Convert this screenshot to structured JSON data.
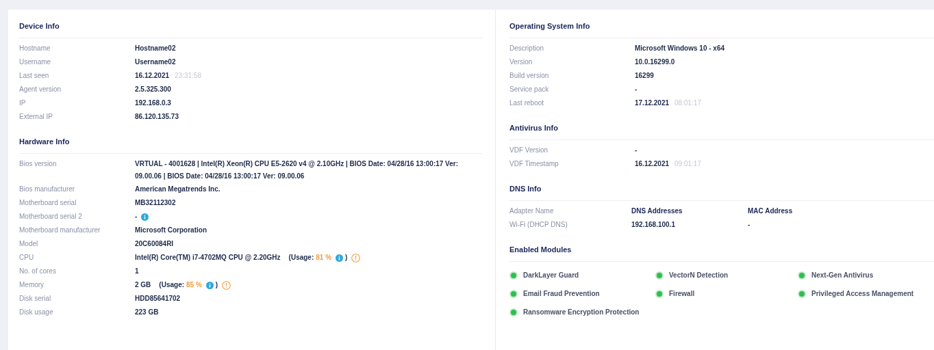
{
  "device_info": {
    "title": "Device Info",
    "rows": [
      {
        "label": "Hostname",
        "value": "Hostname02"
      },
      {
        "label": "Username",
        "value": "Username02"
      },
      {
        "label": "Last seen",
        "value": "16.12.2021",
        "time": "23:31:58"
      },
      {
        "label": "Agent version",
        "value": "2.5.325.300"
      },
      {
        "label": "IP",
        "value": "192.168.0.3"
      },
      {
        "label": "External IP",
        "value": "86.120.135.73"
      }
    ]
  },
  "hardware_info": {
    "title": "Hardware Info",
    "rows": [
      {
        "label": "Bios version",
        "value": "VRTUAL - 4001628 | Intel(R) Xeon(R) CPU E5-2620 v4 @ 2.10GHz | BIOS Date: 04/28/16 13:00:17 Ver: 09.00.06 | BIOS Date: 04/28/16 13:00:17 Ver: 09.00.06",
        "info": false,
        "warning": false
      },
      {
        "label": "Bios manufacturer",
        "value": "American Megatrends Inc.",
        "info": false,
        "warning": false
      },
      {
        "label": "Motherboard serial",
        "value": "MB32112302",
        "info": false,
        "warning": false
      },
      {
        "label": "Motherboard serial 2",
        "value": "-",
        "info": true,
        "warning": false
      },
      {
        "label": "Motherboard manufacturer",
        "value": "Microsoft Corporation",
        "info": false,
        "warning": false
      },
      {
        "label": "Model",
        "value": "20C60084RI",
        "info": false,
        "warning": false
      },
      {
        "label": "CPU",
        "value": "Intel(R) Core(TM) i7-4702MQ CPU @ 2.20GHz",
        "usage": {
          "label": "(Usage:",
          "percent": "81 %",
          "close": ")"
        },
        "info": true,
        "warning": true
      },
      {
        "label": "No. of cores",
        "value": "1",
        "info": false,
        "warning": false
      },
      {
        "label": "Memory",
        "value": "2 GB",
        "usage": {
          "label": "(Usage:",
          "percent": "85 %",
          "close": ")"
        },
        "info": true,
        "warning": true
      },
      {
        "label": "Disk serial",
        "value": "HDD85641702",
        "info": false,
        "warning": false
      },
      {
        "label": "Disk usage",
        "value": "223 GB",
        "info": false,
        "warning": false
      }
    ]
  },
  "os_info": {
    "title": "Operating System Info",
    "rows": [
      {
        "label": "Description",
        "value": "Microsoft Windows 10 - x64"
      },
      {
        "label": "Version",
        "value": "10.0.16299.0"
      },
      {
        "label": "Build version",
        "value": "16299"
      },
      {
        "label": "Service pack",
        "value": "-"
      },
      {
        "label": "Last reboot",
        "value": "17.12.2021",
        "time": "08:01:17"
      }
    ]
  },
  "antivirus_info": {
    "title": "Antivirus Info",
    "rows": [
      {
        "label": "VDF Version",
        "value": "-"
      },
      {
        "label": "VDF Timestamp",
        "value": "16.12.2021",
        "time": "09:01:17"
      }
    ]
  },
  "dns_info": {
    "title": "DNS Info",
    "columns": [
      "Adapter Name",
      "DNS Addresses",
      "MAC Address"
    ],
    "rows": [
      [
        "Wi-Fi (DHCP DNS)",
        "192.168.100.1",
        "-"
      ]
    ]
  },
  "enabled_modules": {
    "title": "Enabled Modules",
    "modules": [
      {
        "name": "DarkLayer Guard",
        "enabled": true
      },
      {
        "name": "VectorN Detection",
        "enabled": true
      },
      {
        "name": "Next-Gen Antivirus",
        "enabled": true
      },
      {
        "name": "Email Fraud Prevention",
        "enabled": true
      },
      {
        "name": "Firewall",
        "enabled": true
      },
      {
        "name": "Privileged Access Management",
        "enabled": true
      },
      {
        "name": "Ransomware Encryption Protection",
        "enabled": true
      }
    ]
  }
}
